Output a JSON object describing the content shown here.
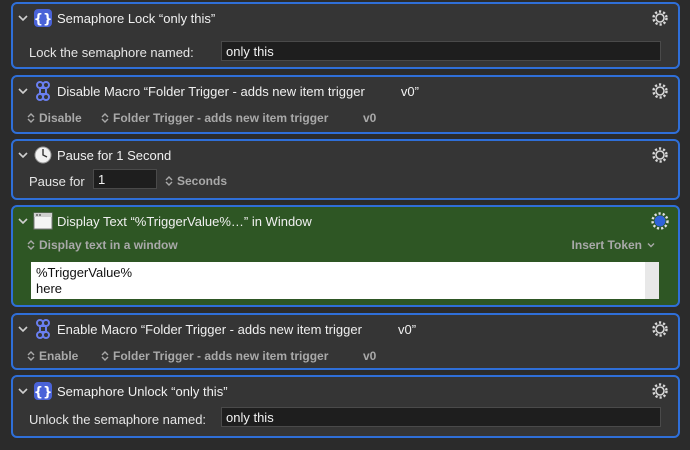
{
  "actions": [
    {
      "title": "Semaphore Lock “only this”",
      "icon": "curly-braces-icon",
      "label": "Lock the semaphore named:",
      "value": "only this"
    },
    {
      "title": "Disable Macro “Folder Trigger - adds new item trigger          v0”",
      "icon": "command-key-icon",
      "mode": "Disable",
      "macro": "Folder Trigger - adds new item trigger",
      "version": "v0"
    },
    {
      "title": "Pause for 1 Second",
      "icon": "clock-icon",
      "label": "Pause for",
      "value": "1",
      "unit": "Seconds"
    },
    {
      "title": "Display Text “%TriggerValue%…” in Window",
      "icon": "window-icon",
      "mode": "Display text in a window",
      "insert_token": "Insert Token",
      "text_lines": [
        "%TriggerValue%",
        "here"
      ]
    },
    {
      "title": "Enable Macro “Folder Trigger - adds new item trigger          v0”",
      "icon": "command-key-icon",
      "mode": "Enable",
      "macro": "Folder Trigger - adds new item trigger",
      "version": "v0"
    },
    {
      "title": "Semaphore Unlock “only this”",
      "icon": "curly-braces-icon",
      "label": "Unlock the semaphore named:",
      "value": "only this"
    }
  ],
  "colors": {
    "selection_border": "#2f6fd8",
    "action_bg": "#353535",
    "active_action_bg": "#2e5624",
    "icon_accent": "#5b7cf0"
  }
}
